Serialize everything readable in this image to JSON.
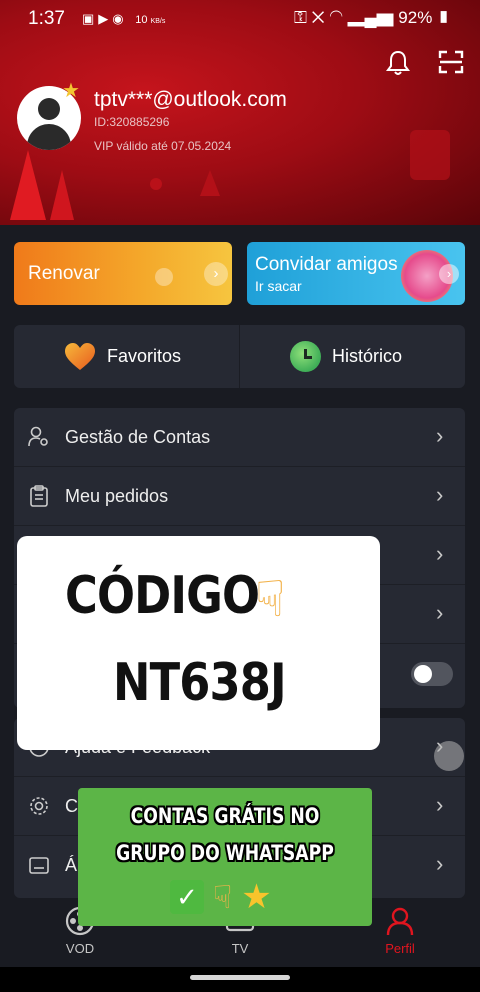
{
  "status_bar": {
    "time": "1:37",
    "network_speed": "10",
    "network_speed_unit": "KB/s",
    "battery": "92%"
  },
  "profile": {
    "email": "tptv***@outlook.com",
    "id": "ID:320885296",
    "vip": "VIP válido até 07.05.2024"
  },
  "promo_buttons": {
    "renew_label": "Renovar",
    "invite_label": "Convidar amigos",
    "invite_sub": "Ir sacar"
  },
  "quick_links": {
    "favorites": "Favoritos",
    "history": "Histórico"
  },
  "menu": {
    "items": [
      {
        "label": "Gestão de Contas",
        "icon": "account-manage-icon"
      },
      {
        "label": "Meu pedidos",
        "icon": "orders-icon"
      },
      {
        "label": "",
        "icon": ""
      },
      {
        "label": "",
        "icon": ""
      },
      {
        "label": "",
        "icon": ""
      },
      {
        "label": "Ajuda e Feedback",
        "icon": "help-icon"
      },
      {
        "label": "C",
        "icon": "settings-icon"
      },
      {
        "label": "Á",
        "icon": "about-icon"
      }
    ]
  },
  "bottom_nav": [
    {
      "label": "VOD",
      "icon": "film-reel-icon",
      "active": false
    },
    {
      "label": "TV",
      "icon": "tv-icon",
      "active": false
    },
    {
      "label": "Perfil",
      "icon": "profile-icon",
      "active": true
    }
  ],
  "overlay_code": {
    "line1": "CÓDIGO",
    "line2": "NT638J"
  },
  "overlay_promo": {
    "line1": "CONTAS GRÁTIS NO",
    "line2": "GRUPO DO WHATSAPP"
  },
  "colors": {
    "accent_red": "#e0151f",
    "card_bg": "#262933",
    "page_bg": "#191b22"
  }
}
